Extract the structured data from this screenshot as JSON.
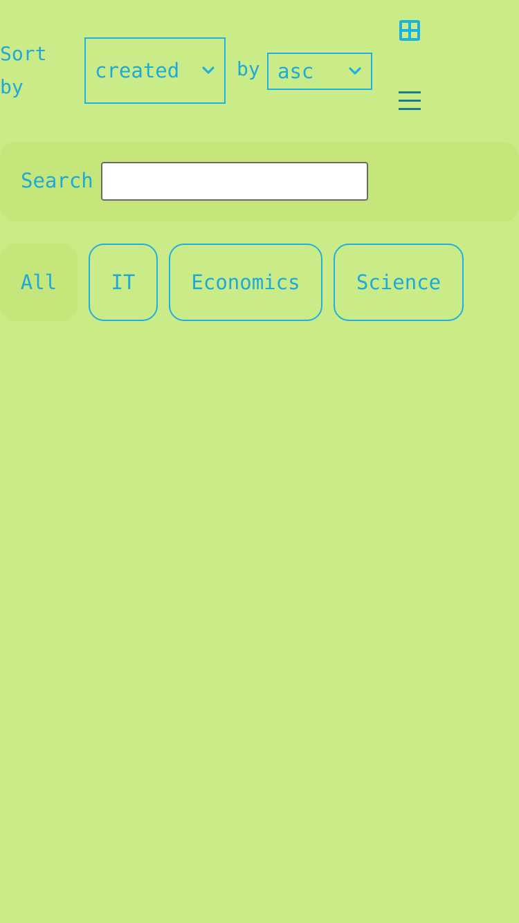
{
  "sort": {
    "label": "Sort by",
    "field_value": "created",
    "by_label": "by",
    "order_value": "asc"
  },
  "view_toggle": {
    "grid_icon": "grid-icon",
    "list_icon": "hamburger-menu-icon"
  },
  "search": {
    "label": "Search",
    "value": "",
    "placeholder": ""
  },
  "categories": [
    {
      "label": "All",
      "active": true
    },
    {
      "label": "IT",
      "active": false
    },
    {
      "label": "Economics",
      "active": false
    },
    {
      "label": "Science",
      "active": false
    }
  ],
  "colors": {
    "background": "#caec88",
    "panel": "#c5e67b",
    "accent": "#1fb0dc",
    "text": "#1fa9d6",
    "menu_icon": "#1b7c8c"
  }
}
